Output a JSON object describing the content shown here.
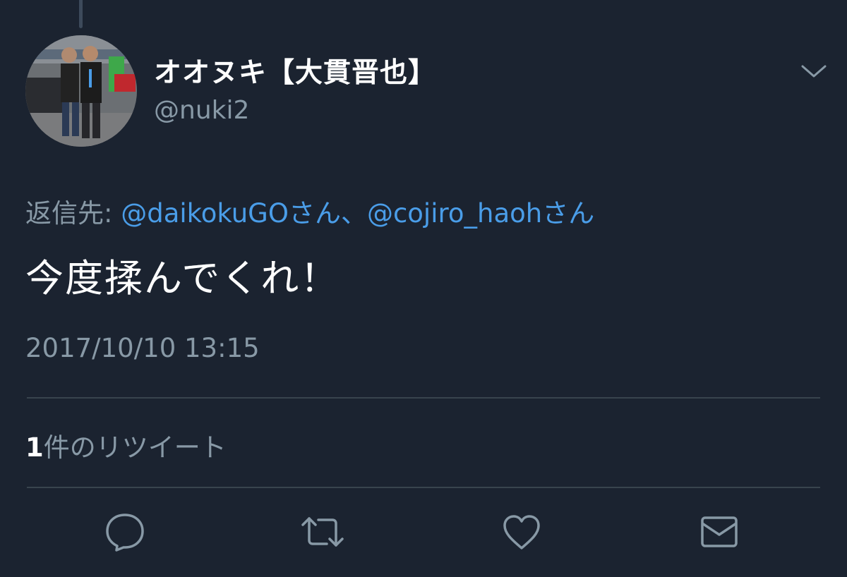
{
  "tweet": {
    "author": {
      "display_name": "オオヌキ【大貫晋也】",
      "handle": "@nuki2"
    },
    "reply_to": {
      "prefix": "返信先: ",
      "mentions": [
        {
          "text": "@daikokuGOさん"
        },
        {
          "text": "@cojiro_haohさん"
        }
      ],
      "separator": "、"
    },
    "text": "今度揉んでくれ！",
    "timestamp": "2017/10/10 13:15",
    "stats": {
      "retweet_count": "1",
      "retweet_label": "件のリツイート"
    }
  },
  "icons": {
    "more": "chevron-down-icon",
    "reply": "speech-bubble-icon",
    "retweet": "retweet-arrows-icon",
    "like": "heart-icon",
    "dm": "envelope-icon"
  },
  "colors": {
    "background": "#1b2330",
    "text_primary": "#ffffff",
    "text_secondary": "#8899a6",
    "accent": "#4a9de8",
    "divider": "#38444d"
  }
}
